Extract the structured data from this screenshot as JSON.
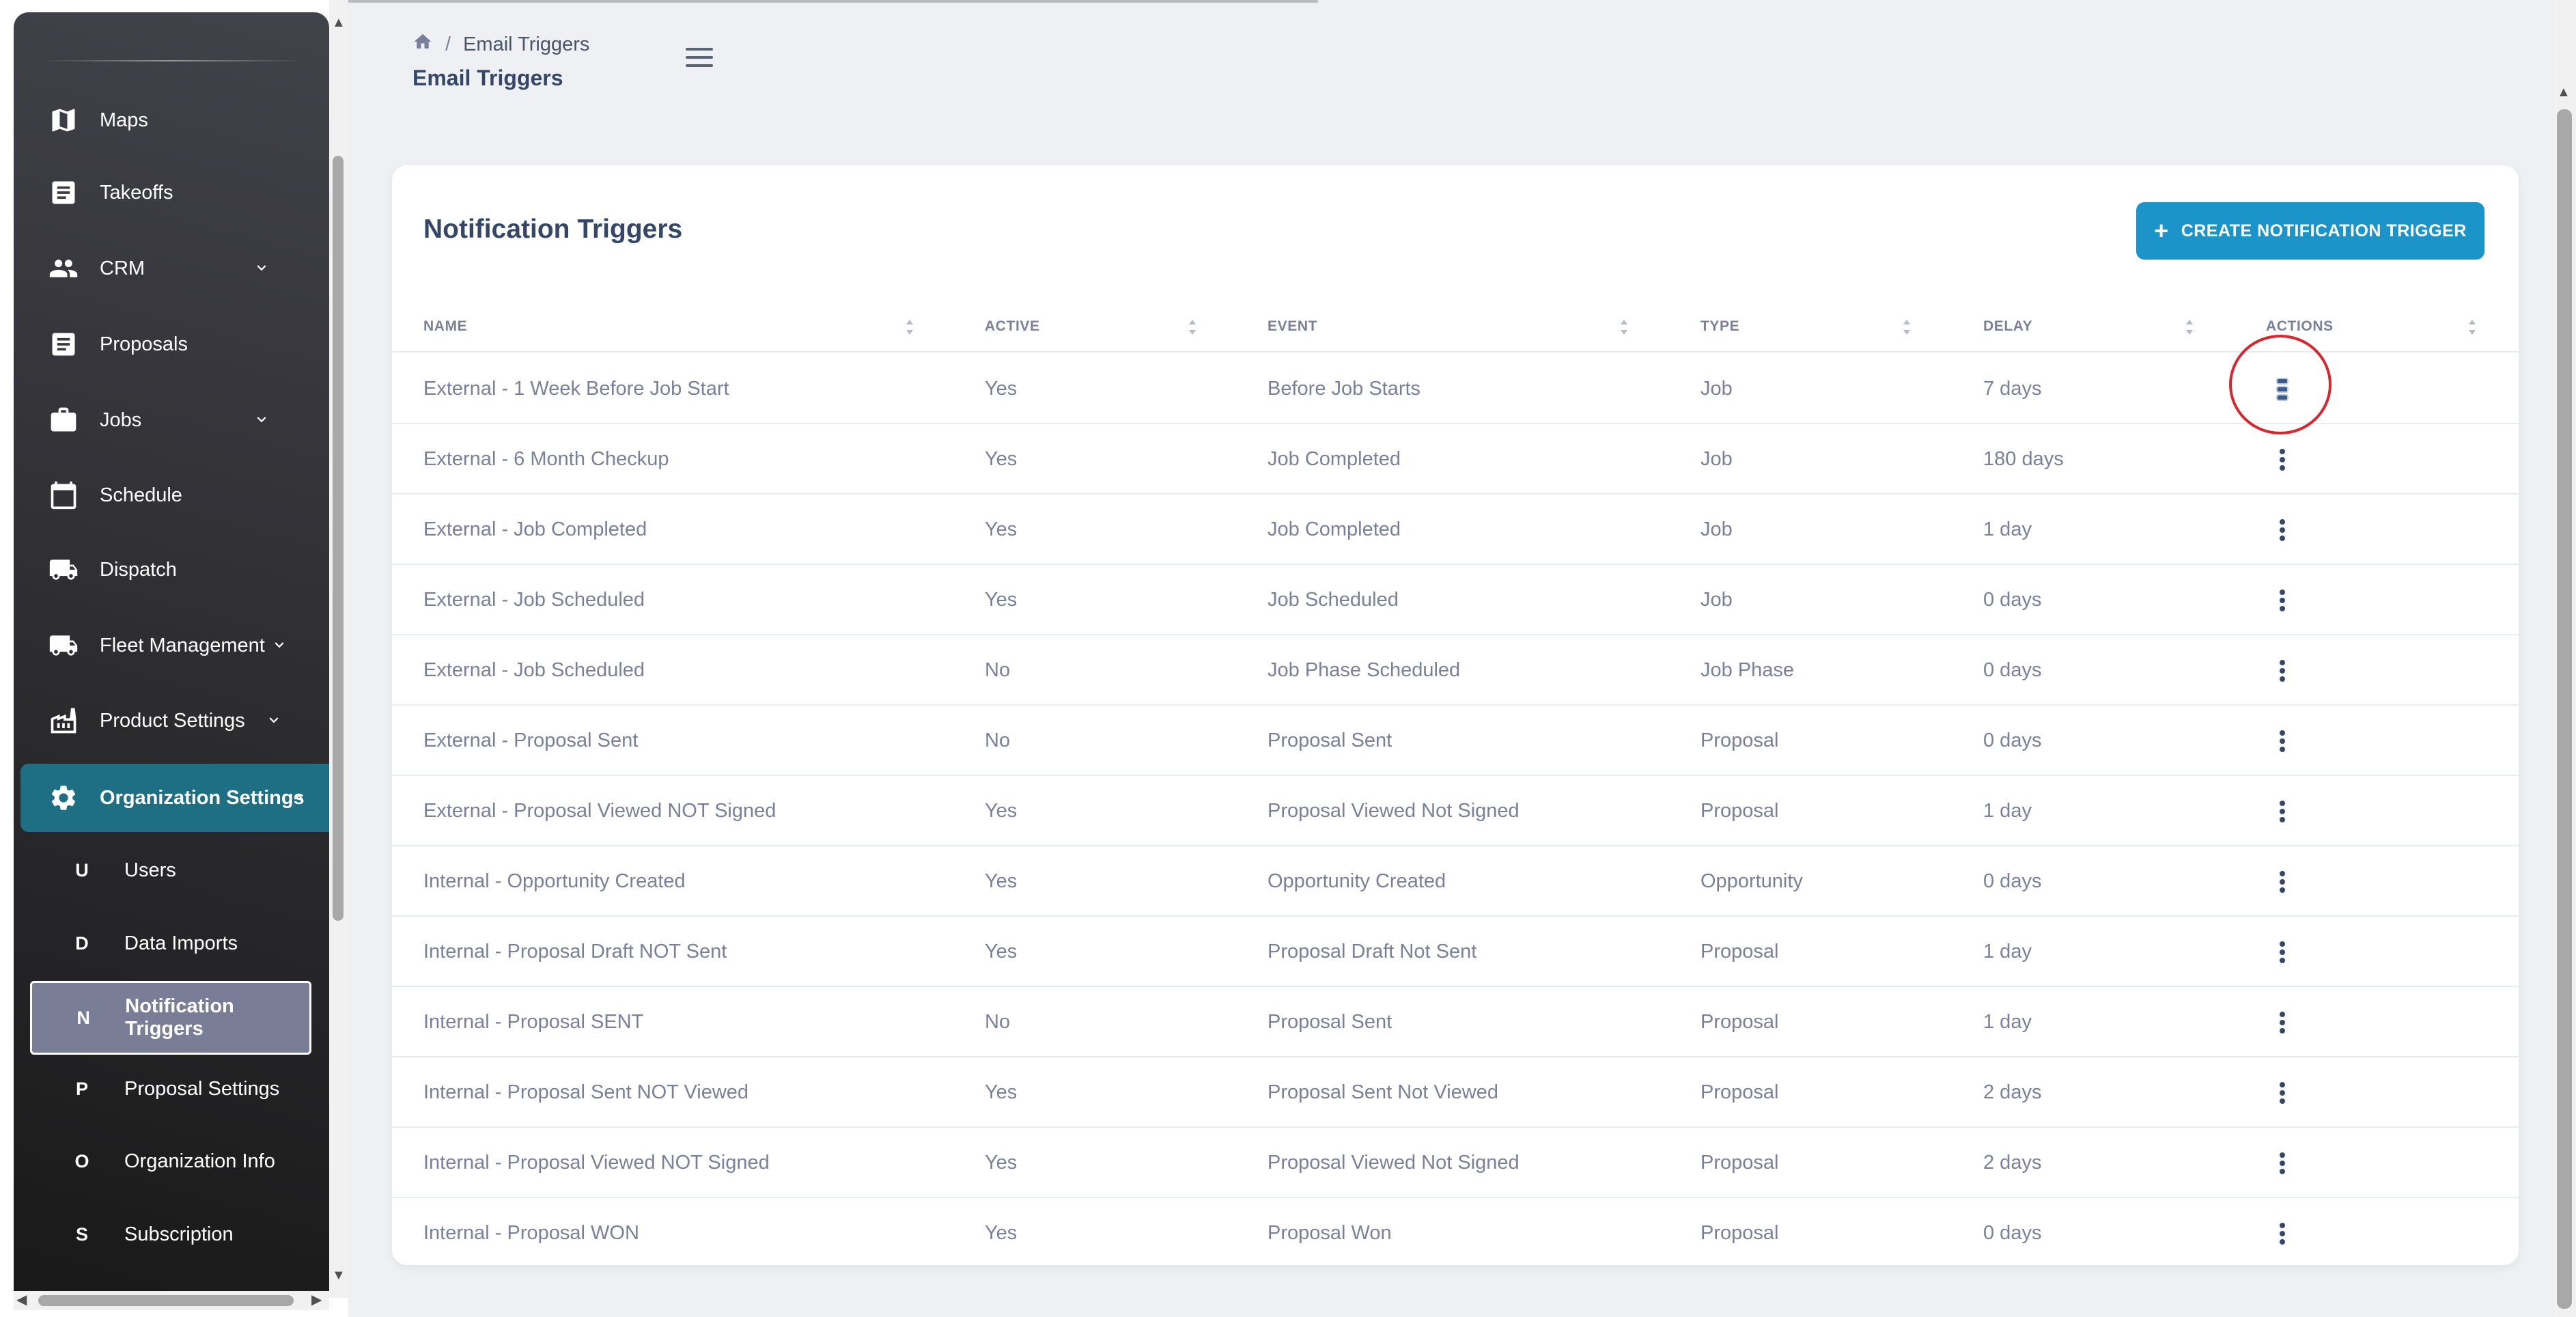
{
  "breadcrumb": {
    "current": "Email Triggers"
  },
  "page_title": "Email Triggers",
  "sidebar": {
    "items": [
      {
        "label": "Maps",
        "icon": "map-icon"
      },
      {
        "label": "Takeoffs",
        "icon": "document-icon"
      },
      {
        "label": "CRM",
        "icon": "people-icon"
      },
      {
        "label": "Proposals",
        "icon": "document-icon"
      },
      {
        "label": "Jobs",
        "icon": "briefcase-icon"
      },
      {
        "label": "Schedule",
        "icon": "calendar-icon"
      },
      {
        "label": "Dispatch",
        "icon": "truck-icon"
      },
      {
        "label": "Fleet Management",
        "icon": "truck-icon"
      },
      {
        "label": "Product Settings",
        "icon": "factory-icon"
      },
      {
        "label": "Organization Settings",
        "icon": "gear-icon"
      }
    ],
    "sub_items": [
      {
        "letter": "U",
        "label": "Users"
      },
      {
        "letter": "D",
        "label": "Data Imports"
      },
      {
        "letter": "N",
        "label": "Notification Triggers"
      },
      {
        "letter": "P",
        "label": "Proposal Settings"
      },
      {
        "letter": "O",
        "label": "Organization Info"
      },
      {
        "letter": "S",
        "label": "Subscription"
      }
    ]
  },
  "card": {
    "title": "Notification Triggers",
    "create_button": "CREATE NOTIFICATION TRIGGER",
    "columns": [
      "NAME",
      "ACTIVE",
      "EVENT",
      "TYPE",
      "DELAY",
      "ACTIONS"
    ],
    "rows": [
      {
        "name": "External - 1 Week Before Job Start",
        "active": "Yes",
        "event": "Before Job Starts",
        "type": "Job",
        "delay": "7 days"
      },
      {
        "name": "External - 6 Month Checkup",
        "active": "Yes",
        "event": "Job Completed",
        "type": "Job",
        "delay": "180 days"
      },
      {
        "name": "External - Job Completed",
        "active": "Yes",
        "event": "Job Completed",
        "type": "Job",
        "delay": "1 day"
      },
      {
        "name": "External - Job Scheduled",
        "active": "Yes",
        "event": "Job Scheduled",
        "type": "Job",
        "delay": "0 days"
      },
      {
        "name": "External - Job Scheduled",
        "active": "No",
        "event": "Job Phase Scheduled",
        "type": "Job Phase",
        "delay": "0 days"
      },
      {
        "name": "External - Proposal Sent",
        "active": "No",
        "event": "Proposal Sent",
        "type": "Proposal",
        "delay": "0 days"
      },
      {
        "name": "External - Proposal Viewed NOT Signed",
        "active": "Yes",
        "event": "Proposal Viewed Not Signed",
        "type": "Proposal",
        "delay": "1 day"
      },
      {
        "name": "Internal - Opportunity Created",
        "active": "Yes",
        "event": "Opportunity Created",
        "type": "Opportunity",
        "delay": "0 days"
      },
      {
        "name": "Internal - Proposal Draft NOT Sent",
        "active": "Yes",
        "event": "Proposal Draft Not Sent",
        "type": "Proposal",
        "delay": "1 day"
      },
      {
        "name": "Internal - Proposal SENT",
        "active": "No",
        "event": "Proposal Sent",
        "type": "Proposal",
        "delay": "1 day"
      },
      {
        "name": "Internal - Proposal Sent NOT Viewed",
        "active": "Yes",
        "event": "Proposal Sent Not Viewed",
        "type": "Proposal",
        "delay": "2 days"
      },
      {
        "name": "Internal - Proposal Viewed NOT Signed",
        "active": "Yes",
        "event": "Proposal Viewed Not Signed",
        "type": "Proposal",
        "delay": "2 days"
      },
      {
        "name": "Internal - Proposal WON",
        "active": "Yes",
        "event": "Proposal Won",
        "type": "Proposal",
        "delay": "0 days"
      }
    ]
  },
  "colors": {
    "accent": "#1a94c9",
    "active_nav": "#1f6f84",
    "annotation_circle": "#d9262e"
  }
}
